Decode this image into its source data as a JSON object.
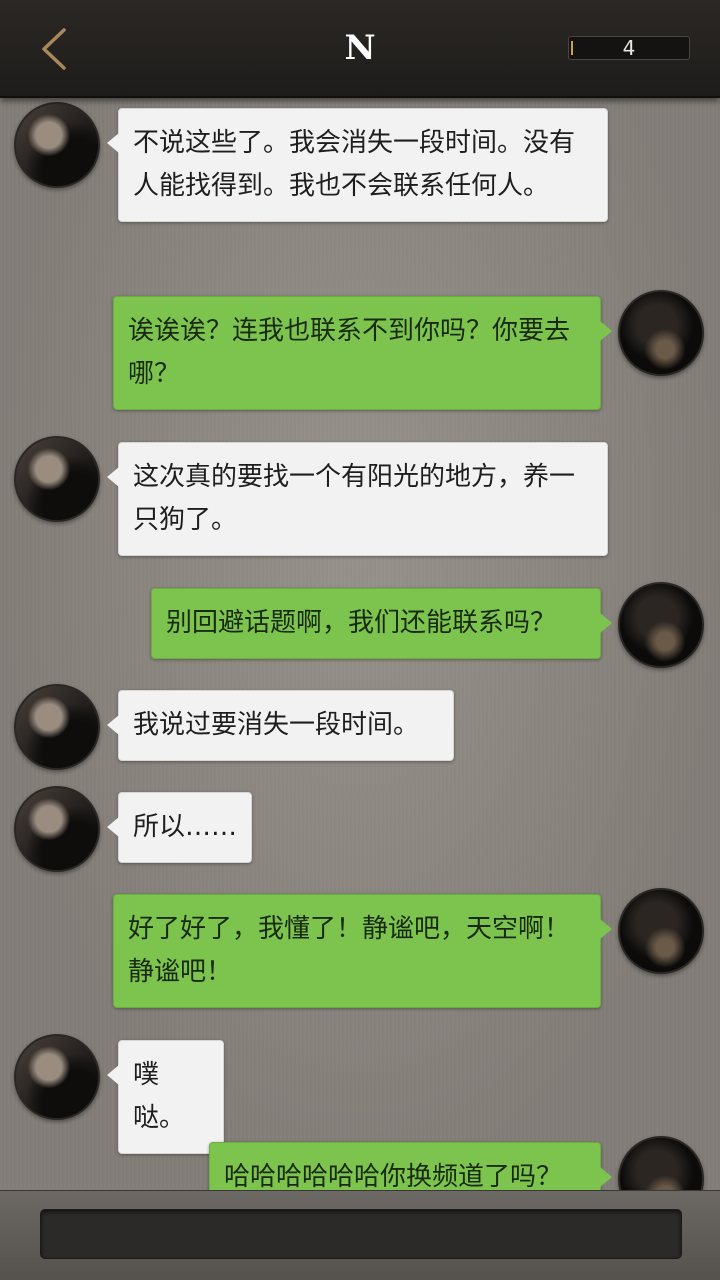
{
  "header": {
    "title": "N",
    "counter": "4"
  },
  "messages": [
    {
      "side": "left",
      "text": "不说这些了。我会消失一段时间。没有人能找得到。我也不会联系任何人。"
    },
    {
      "side": "right",
      "text": "诶诶诶？连我也联系不到你吗？你要去哪？"
    },
    {
      "side": "left",
      "text": "这次真的要找一个有阳光的地方，养一只狗了。"
    },
    {
      "side": "right",
      "text": "别回避话题啊，我们还能联系吗？"
    },
    {
      "side": "left",
      "text": "我说过要消失一段时间。"
    },
    {
      "side": "left",
      "text": "所以……"
    },
    {
      "side": "right",
      "text": "好了好了，我懂了！静谧吧，天空啊！静谧吧！"
    },
    {
      "side": "left",
      "text": "噗哒。"
    },
    {
      "side": "right",
      "text": "哈哈哈哈哈哈你换频道了吗？"
    }
  ],
  "footer": {
    "input_value": ""
  }
}
